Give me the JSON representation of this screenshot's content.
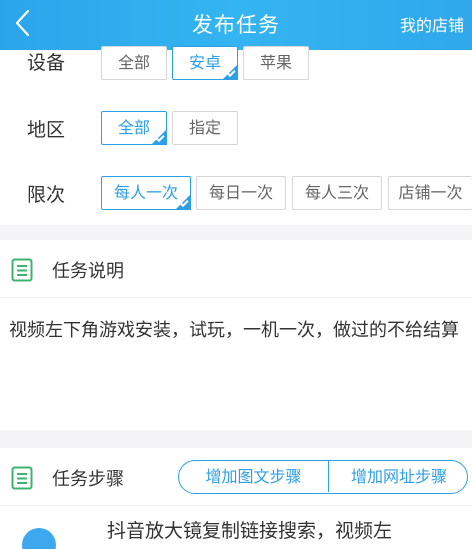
{
  "header": {
    "title": "发布任务",
    "right_link": "我的店铺"
  },
  "options": {
    "device": {
      "label": "设备",
      "choices": [
        "全部",
        "安卓",
        "苹果"
      ],
      "selected": "安卓"
    },
    "region": {
      "label": "地区",
      "choices": [
        "全部",
        "指定"
      ],
      "selected": "全部"
    },
    "limit": {
      "label": "限次",
      "choices": [
        "每人一次",
        "每日一次",
        "每人三次",
        "店铺一次"
      ],
      "selected": "每人一次"
    }
  },
  "description": {
    "title": "任务说明",
    "text": "视频左下角游戏安装，试玩，一机一次，做过的不给结算"
  },
  "steps": {
    "title": "任务步骤",
    "add_image_step": "增加图文步骤",
    "add_url_step": "增加网址步骤",
    "first_step_text": "抖音放大镜复制链接搜索，视频左"
  },
  "colors": {
    "accent": "#2e9fe6",
    "header": "#34b4f0",
    "doc_icon": "#3db46d"
  },
  "icons": {
    "back": "chevron-left-icon",
    "section": "document-icon"
  }
}
